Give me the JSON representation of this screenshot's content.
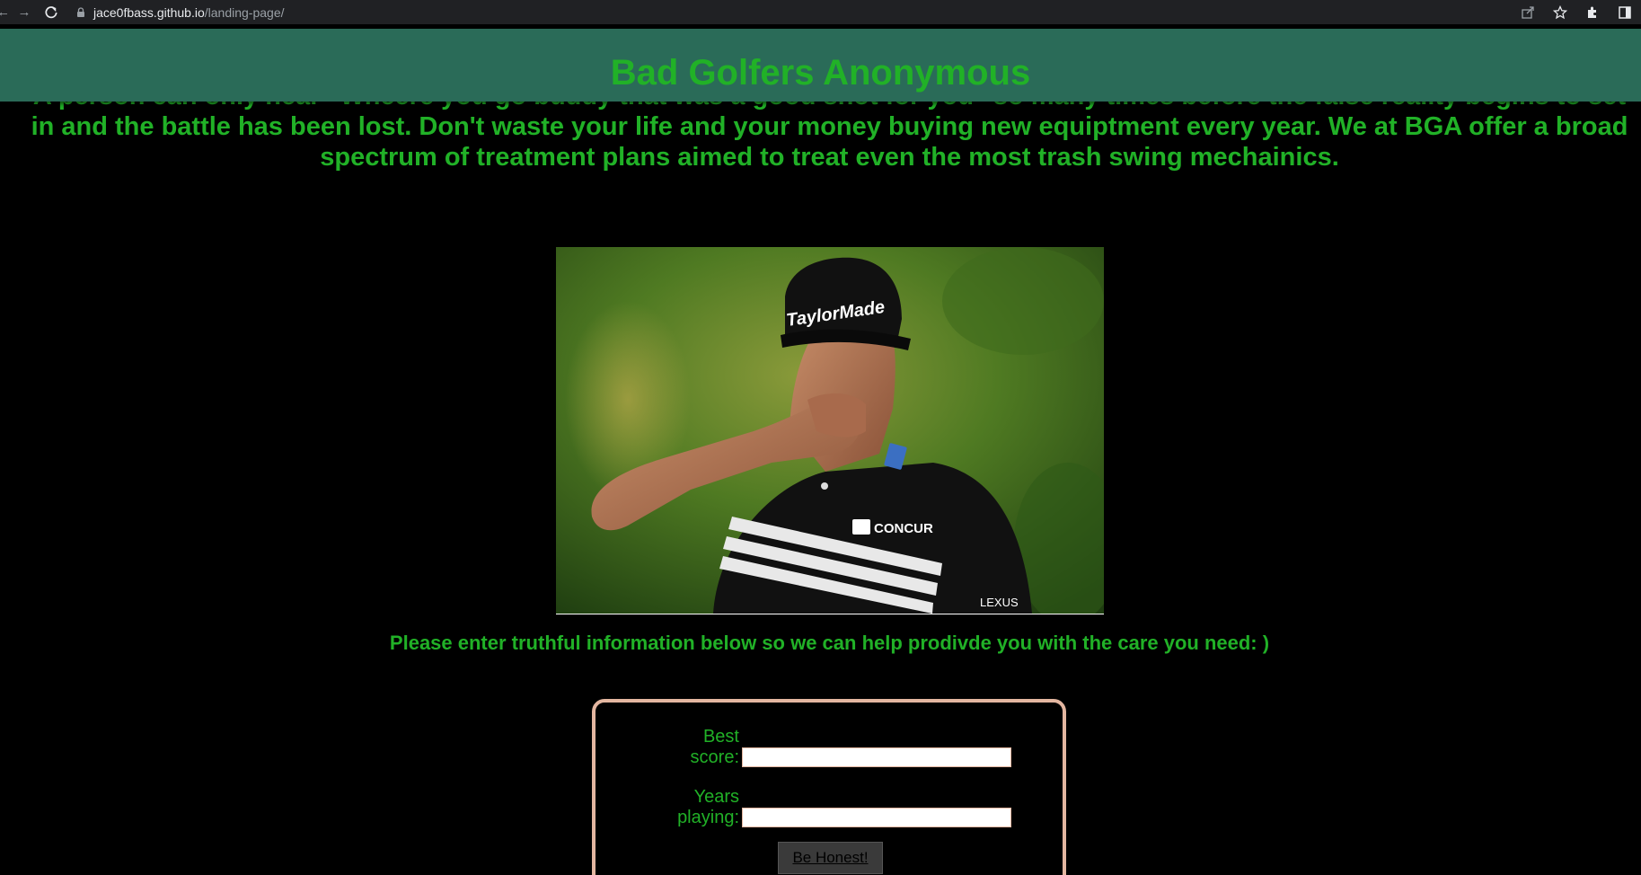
{
  "browser": {
    "url_host": "jace0fbass.github.io",
    "url_path": "/landing-page/"
  },
  "page": {
    "title": "Bad Golfers Anonymous",
    "intro_line1": "A person can only hear \"Wheere you go buddy that was a good shot for you\" so many times before the false reality begins to set",
    "intro_line2": "in and the battle has been lost. Don't waste your life and your money buying new equiptment every year. We at BGA offer a broad",
    "intro_line3": "spectrum of treatment plans aimed to treat even the most trash swing mechainics.",
    "prompt": "Please enter truthful information below so we can help prodivde you with the care you need: )",
    "photo_brand_cap": "TaylorMade",
    "photo_brand_shirt": "CONCUR",
    "photo_brand_sleeve": "LEXUS"
  },
  "form": {
    "best_score_label": "Best score:",
    "best_score_value": "",
    "years_playing_label": "Years playing:",
    "years_playing_value": "",
    "submit_label": "Be Honest!"
  },
  "colors": {
    "header_bg": "#2a6b58",
    "accent_green": "#21b127",
    "card_border": "#e3b6a0",
    "page_bg": "#000000"
  }
}
